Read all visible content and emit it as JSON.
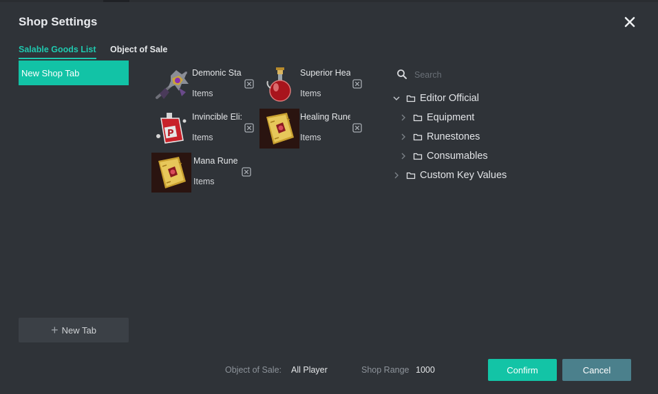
{
  "dialog": {
    "title": "Shop Settings"
  },
  "tabs": {
    "salable_goods": "Salable Goods List",
    "object_of_sale": "Object of Sale"
  },
  "shop_tabs": {
    "items": [
      {
        "label": "New Shop Tab"
      }
    ],
    "new_tab_label": "New Tab"
  },
  "goods": [
    {
      "name": "Demonic Sta",
      "type": "Items",
      "icon": "demonic-staff-icon"
    },
    {
      "name": "Superior Hea",
      "type": "Items",
      "icon": "superior-health-potion-icon"
    },
    {
      "name": "Invincible Eli:",
      "type": "Items",
      "icon": "invincible-elixir-icon"
    },
    {
      "name": "Healing Rune",
      "type": "Items",
      "icon": "healing-rune-icon"
    },
    {
      "name": "Mana Rune",
      "type": "Items",
      "icon": "mana-rune-icon"
    }
  ],
  "search": {
    "placeholder": "Search"
  },
  "tree": {
    "root": "Editor Official",
    "children": [
      "Equipment",
      "Runestones",
      "Consumables"
    ],
    "custom": "Custom Key Values"
  },
  "footer": {
    "object_of_sale_label": "Object of Sale:",
    "object_of_sale_value": "All Player",
    "shop_range_label": "Shop Range",
    "shop_range_value": "1000",
    "confirm": "Confirm",
    "cancel": "Cancel"
  },
  "colors": {
    "accent": "#13c4a6",
    "cancel": "#4b808c",
    "background": "#2f3338"
  }
}
